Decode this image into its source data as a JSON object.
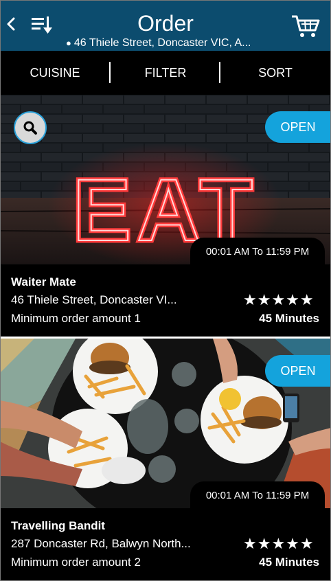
{
  "header": {
    "title": "Order",
    "address": "46 Thiele Street, Doncaster VIC, A...",
    "back_icon": "back-chevron-icon",
    "sort_icon": "sort-list-icon",
    "cart_icon": "cart-icon"
  },
  "tabs": [
    {
      "label": "CUISINE"
    },
    {
      "label": "FILTER"
    },
    {
      "label": "SORT"
    }
  ],
  "restaurants": [
    {
      "status": "OPEN",
      "hours": "00:01 AM To 11:59 PM",
      "name": "Waiter Mate",
      "address": "46 Thiele Street, Doncaster VI...",
      "min_order": "Minimum order amount 1",
      "rating": 5,
      "stars": "★★★★★",
      "delivery_time": "45 Minutes",
      "image_text": "EAT"
    },
    {
      "status": "OPEN",
      "hours": "00:01 AM To 11:59 PM",
      "name": "Travelling Bandit",
      "address": "287 Doncaster Rd, Balwyn North...",
      "min_order": "Minimum order amount 2",
      "rating": 5,
      "stars": "★★★★★",
      "delivery_time": "45 Minutes"
    }
  ],
  "colors": {
    "header_bg": "#0c4c6e",
    "accent": "#14a3dc",
    "neon": "#ff3a3a"
  }
}
